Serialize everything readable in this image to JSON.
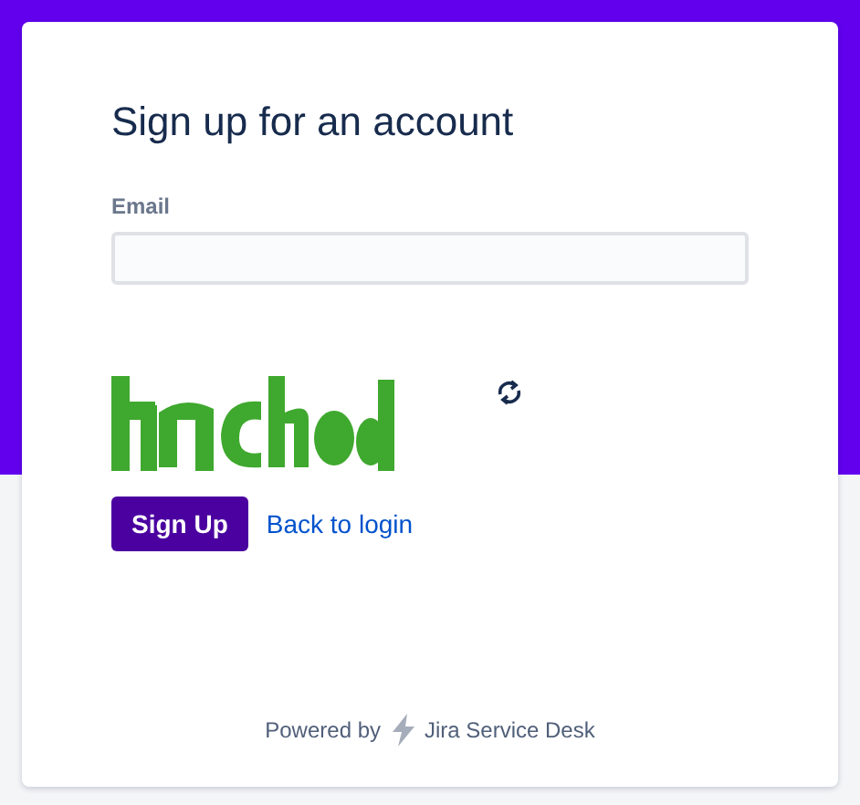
{
  "form": {
    "title": "Sign up for an account",
    "email": {
      "label": "Email"
    },
    "buttons": [
      {
        "kind": "primary",
        "label": "Sign Up"
      },
      {
        "kind": "link",
        "label": "Back to login"
      }
    ]
  },
  "footer": {
    "prefix": "Powered by",
    "product": "Jira Service Desk"
  }
}
